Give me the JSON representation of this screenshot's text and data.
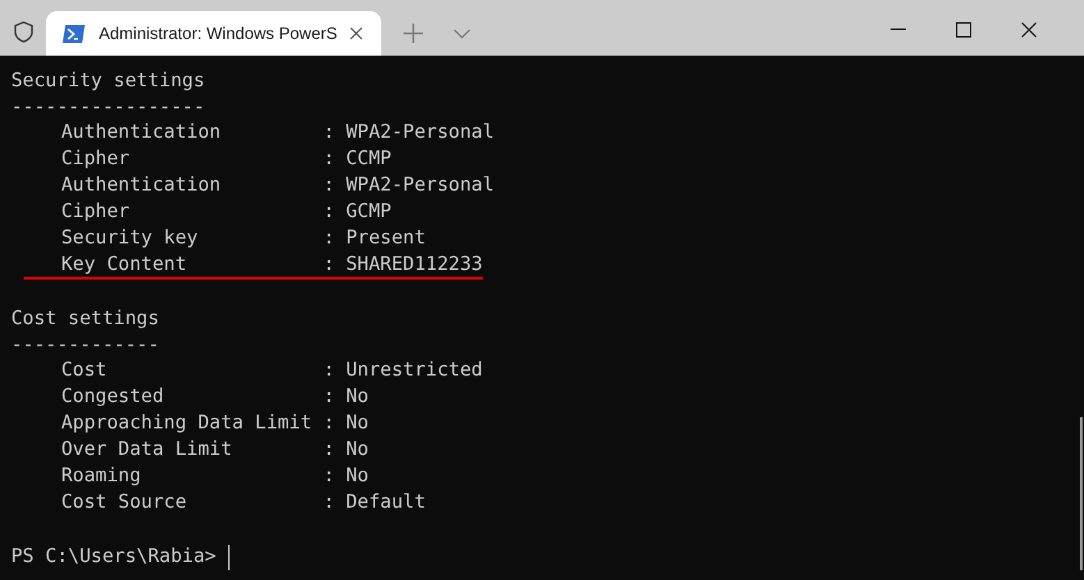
{
  "tab": {
    "title": "Administrator: Windows PowerS",
    "selected": true
  },
  "sections": [
    {
      "title": "Security settings",
      "rule": "-----------------",
      "rows": [
        {
          "text": "Authentication         : WPA2-Personal",
          "underlined": false
        },
        {
          "text": "Cipher                 : CCMP",
          "underlined": false
        },
        {
          "text": "Authentication         : WPA2-Personal",
          "underlined": false
        },
        {
          "text": "Cipher                 : GCMP",
          "underlined": false
        },
        {
          "text": "Security key           : Present",
          "underlined": false
        },
        {
          "text": "Key Content            : SHARED112233",
          "underlined": true
        }
      ]
    },
    {
      "title": "Cost settings",
      "rule": "-------------",
      "rows": [
        {
          "text": "Cost                   : Unrestricted",
          "underlined": false
        },
        {
          "text": "Congested              : No",
          "underlined": false
        },
        {
          "text": "Approaching Data Limit : No",
          "underlined": false
        },
        {
          "text": "Over Data Limit        : No",
          "underlined": false
        },
        {
          "text": "Roaming                : No",
          "underlined": false
        },
        {
          "text": "Cost Source            : Default",
          "underlined": false
        }
      ]
    }
  ],
  "prompt": "PS C:\\Users\\Rabia>"
}
